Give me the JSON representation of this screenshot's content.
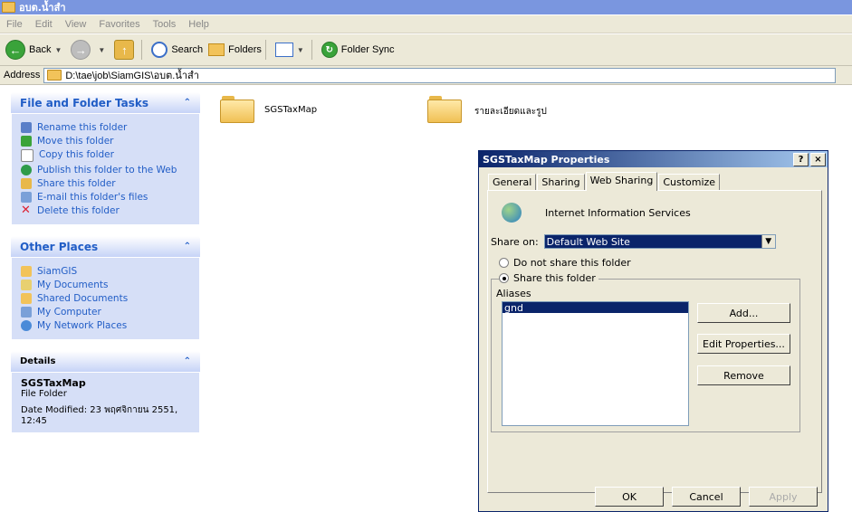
{
  "window": {
    "title": "อบต.น้ำสำ"
  },
  "menu": [
    "File",
    "Edit",
    "View",
    "Favorites",
    "Tools",
    "Help"
  ],
  "toolbar": {
    "back": "Back",
    "search": "Search",
    "folders": "Folders",
    "folder_sync": "Folder Sync"
  },
  "address": {
    "label": "Address",
    "path": "D:\\tae\\job\\SiamGIS\\อบต.น้ำสำ"
  },
  "sidebar": {
    "file_tasks": {
      "title": "File and Folder Tasks",
      "items": [
        "Rename this folder",
        "Move this folder",
        "Copy this folder",
        "Publish this folder to the Web",
        "Share this folder",
        "E-mail this folder's files",
        "Delete this folder"
      ]
    },
    "other_places": {
      "title": "Other Places",
      "items": [
        "SiamGIS",
        "My Documents",
        "Shared Documents",
        "My Computer",
        "My Network Places"
      ]
    },
    "details": {
      "title": "Details",
      "name": "SGSTaxMap",
      "type": "File Folder",
      "modified": "Date Modified: 23 พฤศจิกายน 2551, 12:45"
    }
  },
  "folders": [
    {
      "name": "SGSTaxMap"
    },
    {
      "name": "รายละเอียดและรูป"
    }
  ],
  "dialog": {
    "title": "SGSTaxMap Properties",
    "help_btn": "?",
    "close_btn": "×",
    "tabs": [
      "General",
      "Sharing",
      "Web Sharing",
      "Customize"
    ],
    "iis_label": "Internet Information Services",
    "share_on_label": "Share on:",
    "share_on_value": "Default Web Site",
    "radio_no": "Do not share this folder",
    "radio_yes": "Share this folder",
    "aliases_label": "Aliases",
    "alias_selected": "gnd",
    "add": "Add...",
    "edit": "Edit Properties...",
    "remove": "Remove",
    "ok": "OK",
    "cancel": "Cancel",
    "apply": "Apply"
  }
}
